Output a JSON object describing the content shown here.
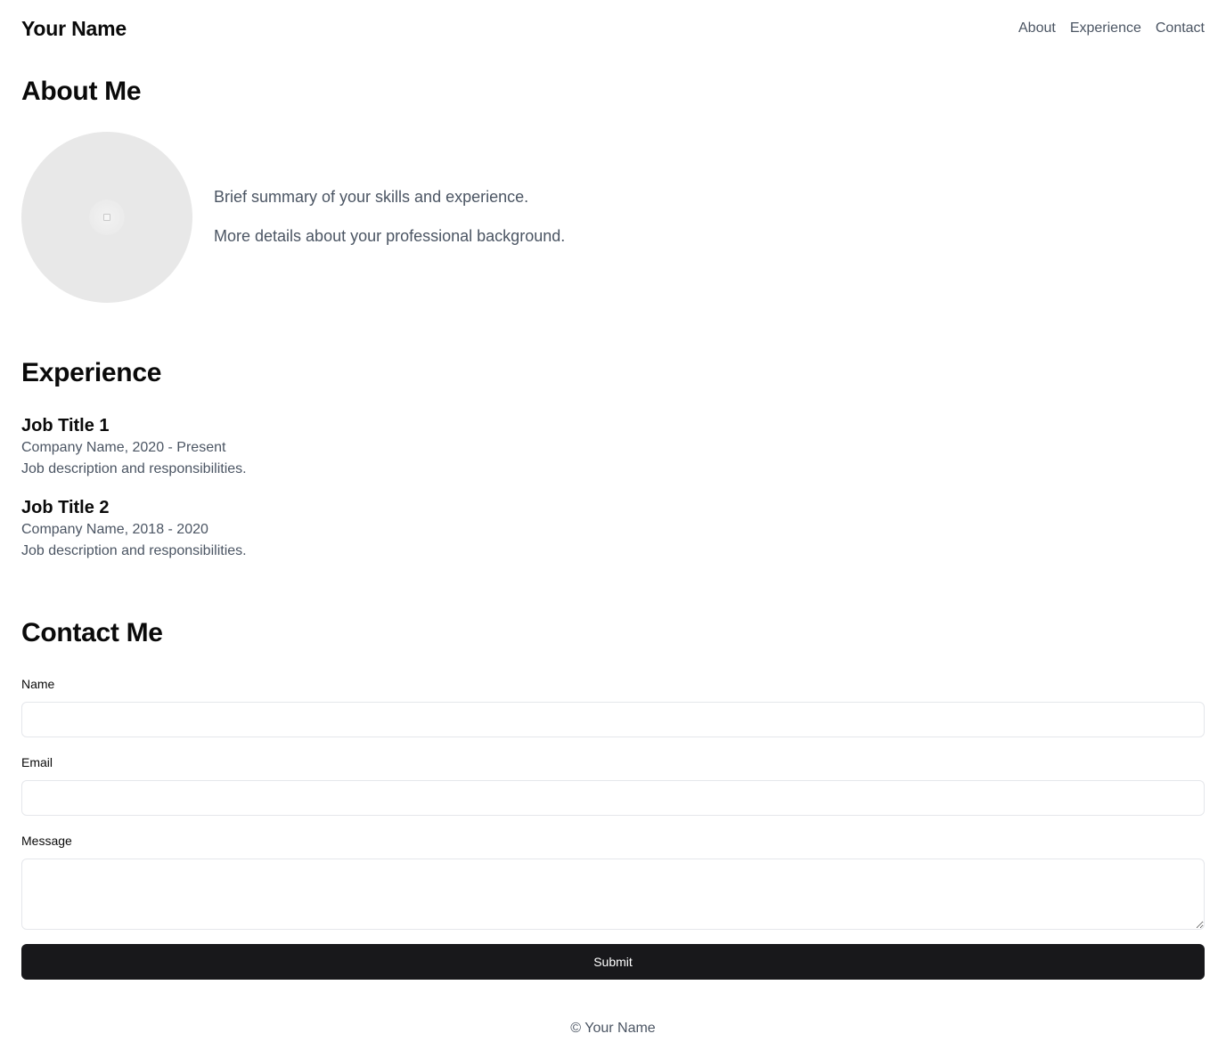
{
  "header": {
    "brand": "Your Name",
    "nav": [
      "About",
      "Experience",
      "Contact"
    ]
  },
  "about": {
    "title": "About Me",
    "summary": "Brief summary of your skills and experience.",
    "details": "More details about your professional background."
  },
  "experience": {
    "title": "Experience",
    "jobs": [
      {
        "title": "Job Title 1",
        "meta": "Company Name, 2020 - Present",
        "description": "Job description and responsibilities."
      },
      {
        "title": "Job Title 2",
        "meta": "Company Name, 2018 - 2020",
        "description": "Job description and responsibilities."
      }
    ]
  },
  "contact": {
    "title": "Contact Me",
    "name_label": "Name",
    "name_value": "",
    "email_label": "Email",
    "email_value": "",
    "message_label": "Message",
    "message_value": "",
    "submit_label": "Submit"
  },
  "footer": {
    "text": "© Your Name"
  },
  "colors": {
    "primary_button": "#18181b",
    "muted_text": "#4b5563",
    "avatar_bg": "#e8e8e8"
  }
}
